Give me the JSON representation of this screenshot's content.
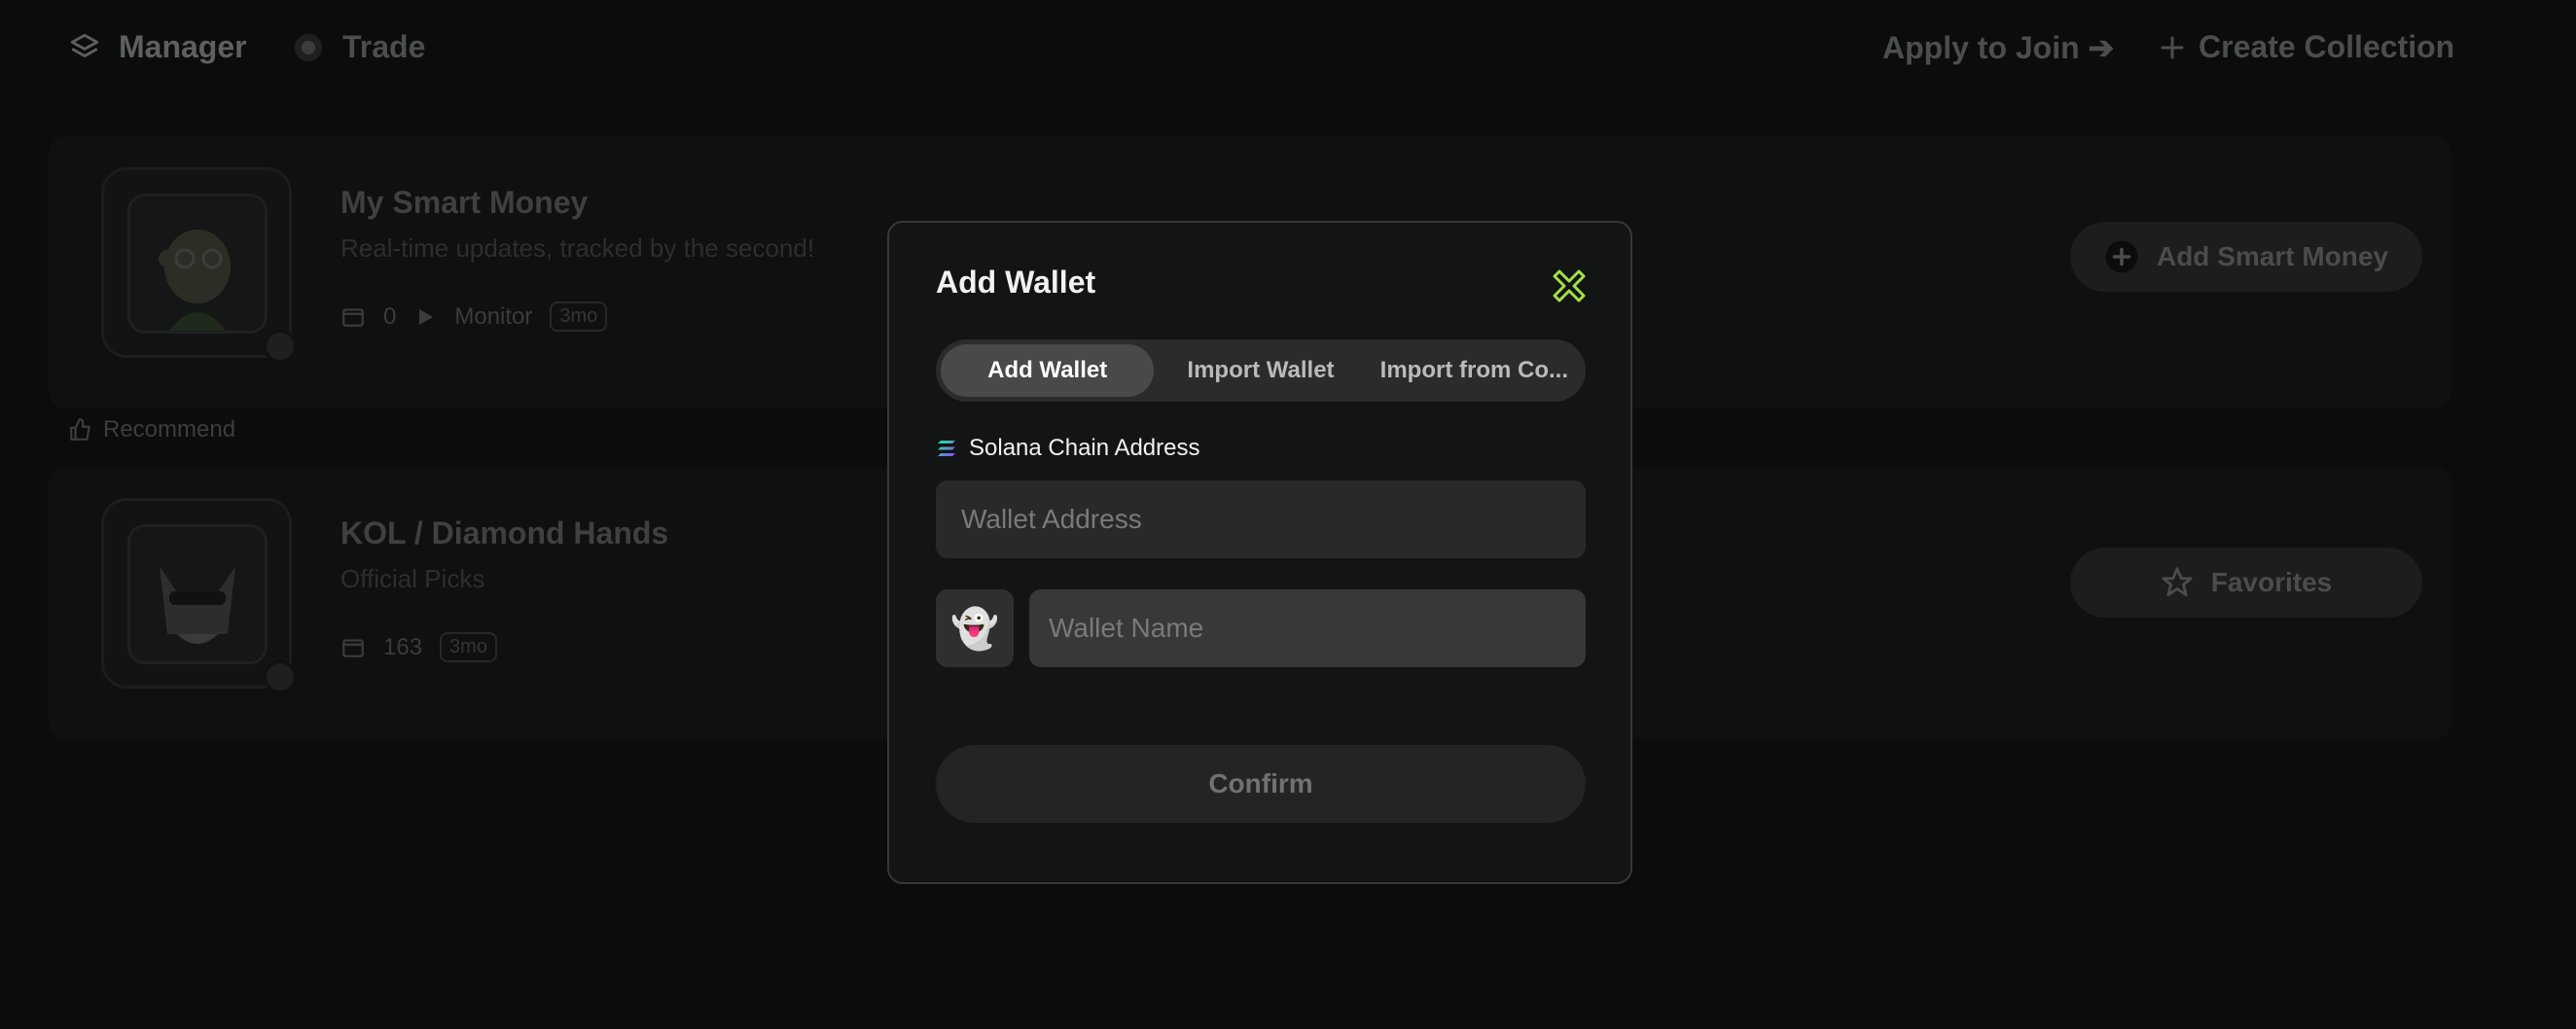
{
  "nav": {
    "manager_label": "Manager",
    "trade_label": "Trade",
    "apply_label": "Apply to Join ➔",
    "create_label": "Create Collection"
  },
  "cards": [
    {
      "title": "My Smart Money",
      "subtitle": "Real-time updates, tracked by the second!",
      "count": "0",
      "monitor_label": "Monitor",
      "age": "3mo",
      "button_label": "Add Smart Money",
      "button_icon": "plus-circle-icon"
    },
    {
      "title": "KOL / Diamond Hands",
      "subtitle": "Official Picks",
      "count": "163",
      "age": "3mo",
      "button_label": "Favorites",
      "button_icon": "star-icon"
    }
  ],
  "recommend_label": "Recommend",
  "modal": {
    "title": "Add Wallet",
    "tabs": [
      {
        "label": "Add Wallet",
        "active": true
      },
      {
        "label": "Import Wallet",
        "active": false
      },
      {
        "label": "Import from Co...",
        "active": false
      }
    ],
    "chain_label": "Solana Chain Address",
    "address_placeholder": "Wallet Address",
    "emoji": "👻",
    "name_placeholder": "Wallet Name",
    "confirm_label": "Confirm"
  },
  "colors": {
    "accent": "#a3e04a",
    "modal_bg": "#131414",
    "page_bg": "#0b0c0b"
  }
}
